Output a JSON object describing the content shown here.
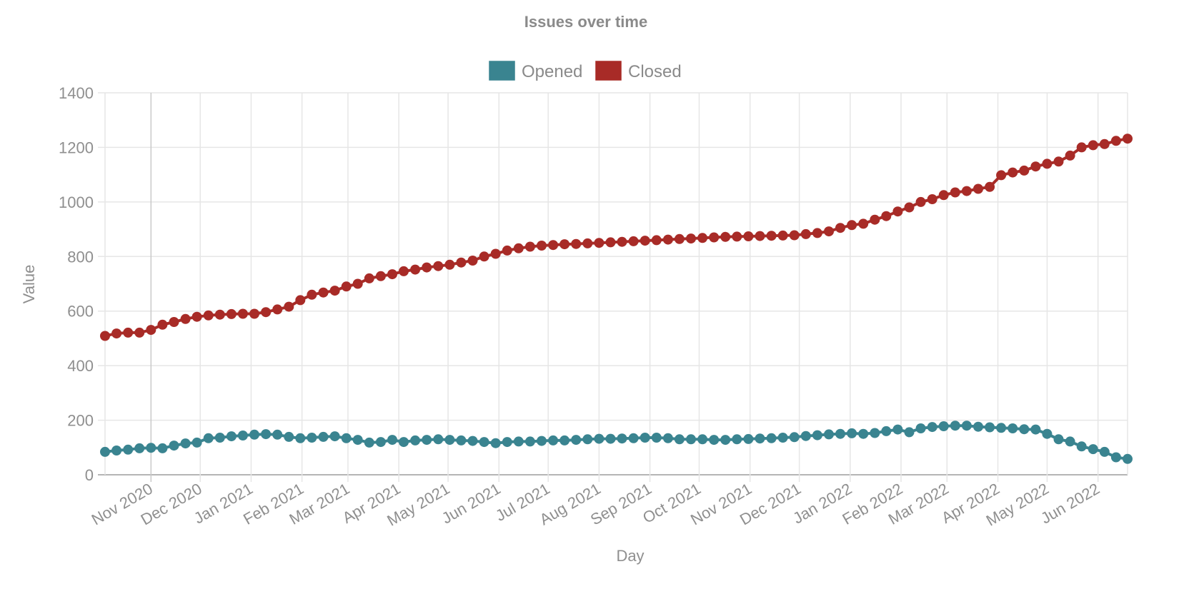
{
  "chart_data": {
    "type": "line",
    "title": "Issues over time",
    "xlabel": "Day",
    "ylabel": "Value",
    "ylim": [
      0,
      1400
    ],
    "yticks": [
      0,
      200,
      400,
      600,
      800,
      1000,
      1200,
      1400
    ],
    "grid": true,
    "legend_position": "top-center",
    "x_start": "2020-10-04",
    "x_interval_days": 7,
    "x_end": "2022-06-19",
    "xtick_labels": [
      "Nov 2020",
      "Dec 2020",
      "Jan 2021",
      "Feb 2021",
      "Mar 2021",
      "Apr 2021",
      "May 2021",
      "Jun 2021",
      "Jul 2021",
      "Aug 2021",
      "Sep 2021",
      "Oct 2021",
      "Nov 2021",
      "Dec 2021",
      "Jan 2022",
      "Feb 2022",
      "Mar 2022",
      "Apr 2022",
      "May 2022",
      "Jun 2022"
    ],
    "xtick_dates": [
      "2020-11-01",
      "2020-12-01",
      "2021-01-01",
      "2021-02-01",
      "2021-03-01",
      "2021-04-01",
      "2021-05-01",
      "2021-06-01",
      "2021-07-01",
      "2021-08-01",
      "2021-09-01",
      "2021-10-01",
      "2021-11-01",
      "2021-12-01",
      "2022-01-01",
      "2022-02-01",
      "2022-03-01",
      "2022-04-01",
      "2022-05-01",
      "2022-06-01"
    ],
    "series": [
      {
        "name": "Opened",
        "color": "#3a8490",
        "values": [
          84,
          89,
          92,
          97,
          99,
          97,
          107,
          115,
          118,
          134,
          136,
          141,
          144,
          147,
          149,
          147,
          139,
          134,
          136,
          139,
          141,
          134,
          128,
          118,
          120,
          128,
          120,
          126,
          128,
          130,
          128,
          126,
          124,
          120,
          116,
          120,
          122,
          122,
          124,
          126,
          126,
          128,
          130,
          132,
          132,
          133,
          134,
          136,
          136,
          134,
          130,
          130,
          130,
          128,
          128,
          130,
          131,
          133,
          134,
          136,
          138,
          142,
          145,
          148,
          150,
          152,
          150,
          153,
          160,
          166,
          156,
          170,
          175,
          178,
          180,
          180,
          176,
          174,
          172,
          170,
          167,
          166,
          150,
          130,
          122,
          104,
          94,
          84,
          64,
          58
        ]
      },
      {
        "name": "Closed",
        "color": "#a82b27",
        "values": [
          509,
          518,
          521,
          521,
          531,
          550,
          560,
          571,
          579,
          584,
          587,
          589,
          590,
          590,
          596,
          606,
          616,
          640,
          660,
          668,
          675,
          690,
          700,
          720,
          728,
          735,
          746,
          752,
          760,
          765,
          770,
          778,
          785,
          800,
          810,
          822,
          830,
          836,
          840,
          842,
          845,
          846,
          848,
          850,
          852,
          854,
          856,
          858,
          860,
          862,
          864,
          866,
          868,
          870,
          872,
          873,
          874,
          875,
          876,
          877,
          878,
          882,
          886,
          892,
          905,
          915,
          920,
          935,
          948,
          965,
          980,
          1000,
          1010,
          1025,
          1035,
          1040,
          1048,
          1055,
          1098,
          1108,
          1115,
          1130,
          1140,
          1148,
          1170,
          1200,
          1208,
          1212,
          1224,
          1232
        ]
      }
    ]
  }
}
